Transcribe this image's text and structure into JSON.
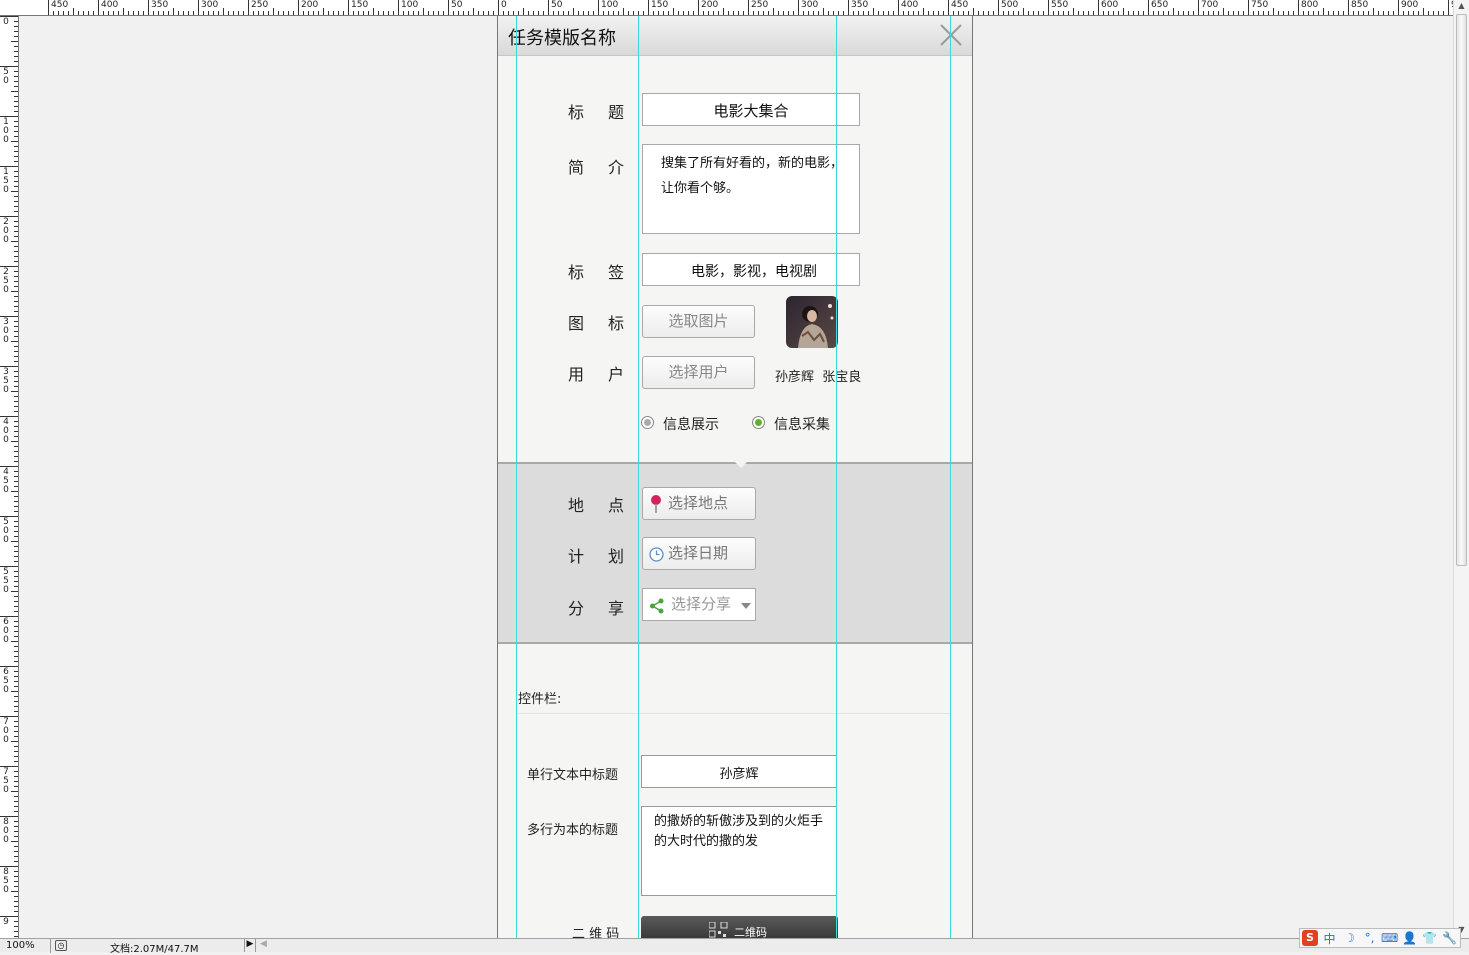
{
  "ruler": {
    "top_labels": [
      "450",
      "400",
      "350",
      "300",
      "250",
      "200",
      "150",
      "100",
      "50",
      "0",
      "50",
      "100",
      "150",
      "200",
      "250",
      "300",
      "350",
      "400",
      "450",
      "500",
      "550",
      "600",
      "650",
      "700",
      "750",
      "800",
      "850",
      "900",
      "9"
    ],
    "left_labels": [
      "0",
      "50",
      "100",
      "150",
      "200",
      "250",
      "300",
      "350",
      "400",
      "450",
      "500",
      "550",
      "600",
      "650",
      "700",
      "750",
      "800",
      "850",
      "9"
    ]
  },
  "dialog": {
    "title": "任务模版名称",
    "fields": {
      "title_label": [
        "标",
        "题"
      ],
      "title_value": "电影大集合",
      "intro_label": [
        "简",
        "介"
      ],
      "intro_value": "搜集了所有好看的，新的电影，让你看个够。",
      "tags_label": [
        "标",
        "签"
      ],
      "tags_value": "电影，影视，电视剧",
      "icon_label": [
        "图",
        "标"
      ],
      "icon_button": "选取图片",
      "user_label": [
        "用",
        "户"
      ],
      "user_button": "选择用户",
      "user_names": "孙彦辉  张宝良"
    },
    "mode": {
      "options": [
        "信息展示",
        "信息采集"
      ],
      "selected": "信息采集",
      "selected_color": "#5ab52a"
    },
    "band": {
      "location_label": [
        "地",
        "点"
      ],
      "location_button": "选择地点",
      "plan_label": [
        "计",
        "划"
      ],
      "plan_button": "选择日期",
      "share_label": [
        "分",
        "享"
      ],
      "share_button": "选择分享"
    },
    "controls": {
      "title": "控件栏:",
      "single_line_label": "单行文本中标题",
      "single_line_value": "孙彦辉",
      "multi_line_label": "多行为本的标题",
      "multi_line_value": "的撒娇的斩傲涉及到的火炬手的大时代的撒的发",
      "qr_label": "二 维 码",
      "qr_button": "二维码"
    }
  },
  "statusbar": {
    "zoom": "100%",
    "doc_info": "文档:2.07M/47.7M"
  },
  "ime": {
    "items": [
      "S",
      "中",
      "☽",
      "°,",
      "⌨",
      "👤",
      "👕",
      "🔧"
    ]
  }
}
